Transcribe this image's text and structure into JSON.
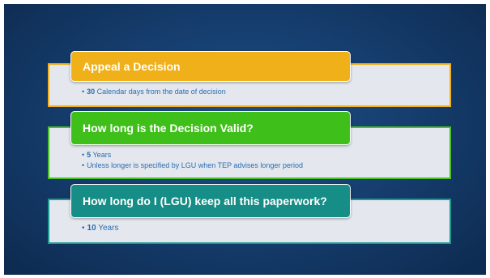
{
  "sections": [
    {
      "heading": "Appeal a Decision",
      "bullets": [
        {
          "bold": "30",
          "text": " Calendar days from the date of decision"
        }
      ],
      "color": "#f0b01a"
    },
    {
      "heading": "How long is the Decision Valid?",
      "bullets": [
        {
          "bold": "5",
          "text": " Years"
        },
        {
          "bold": "",
          "text": "Unless longer is specified by LGU when TEP advises longer period"
        }
      ],
      "color": "#3fbf19"
    },
    {
      "heading": "How long do I (LGU) keep all this paperwork?",
      "bullets": [
        {
          "bold": "10",
          "text": " Years"
        }
      ],
      "color": "#168d86"
    }
  ],
  "colors": {
    "background": "#163f70",
    "panel": "#e4e8ee",
    "bullet_text": "#2a6bb0"
  }
}
